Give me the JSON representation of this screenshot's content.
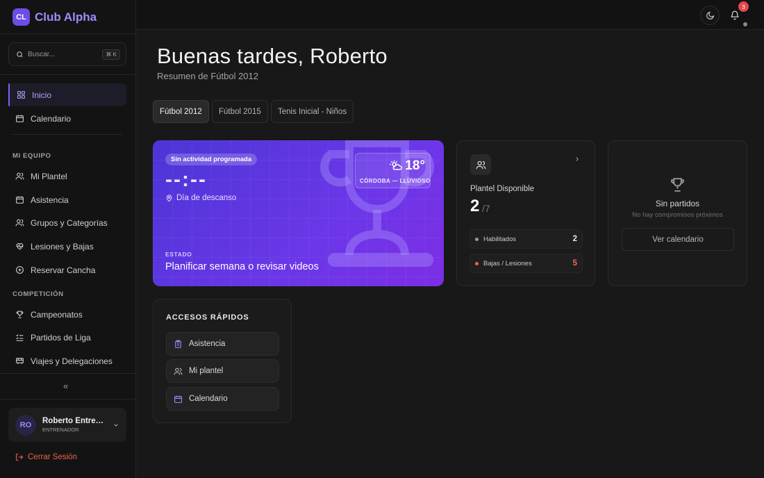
{
  "brand": {
    "logo": "CL",
    "name": "Club Alpha"
  },
  "search": {
    "placeholder": "Buscar...",
    "shortcut": "⌘ K"
  },
  "nav": {
    "main": [
      {
        "label": "Inicio",
        "icon": "grid-icon",
        "active": true
      },
      {
        "label": "Calendario",
        "icon": "calendar-icon"
      }
    ],
    "team_label": "MI EQUIPO",
    "team": [
      {
        "label": "Mi Plantel",
        "icon": "users-icon"
      },
      {
        "label": "Asistencia",
        "icon": "calendar-check-icon"
      },
      {
        "label": "Grupos y Categorías",
        "icon": "users-icon"
      },
      {
        "label": "Lesiones y Bajas",
        "icon": "heart-icon"
      },
      {
        "label": "Reservar Cancha",
        "icon": "plus-circle-icon"
      }
    ],
    "competition_label": "COMPETICIÓN",
    "competition": [
      {
        "label": "Campeonatos",
        "icon": "trophy-icon"
      },
      {
        "label": "Partidos de Liga",
        "icon": "list-check-icon"
      },
      {
        "label": "Viajes y Delegaciones",
        "icon": "bus-icon"
      }
    ],
    "collapse": "«"
  },
  "user": {
    "initials": "RO",
    "name": "Roberto Entrenador",
    "role": "ENTRENADOR"
  },
  "logout": "Cerrar Sesión",
  "topbar": {
    "notifications": "3"
  },
  "greeting": "Buenas tardes, Roberto",
  "subtitle": "Resumen de Fútbol 2012",
  "tabs": [
    "Fútbol 2012",
    "Fútbol 2015",
    "Tenis Inicial - Niños"
  ],
  "hero": {
    "pill": "Sin actividad programada",
    "time": "--:--",
    "rest": "Día de descanso",
    "estado_label": "ESTADO",
    "estado_value": "Planificar semana o revisar videos",
    "weather": {
      "temp": "18°",
      "location": "CÓRDOBA — LLUVIOSO"
    }
  },
  "plantel": {
    "label": "Plantel Disponible",
    "available": "2",
    "total": "/7",
    "rows": [
      {
        "label": "Habilitados",
        "value": "2",
        "color": "#9a9a9a",
        "value_color": "#e8e8eb"
      },
      {
        "label": "Bajas / Lesiones",
        "value": "5",
        "color": "#e8654f",
        "value_color": "#f06a55"
      }
    ]
  },
  "partidos": {
    "title": "Sin partidos",
    "subtitle": "No hay compromisos próximos",
    "button": "Ver calendario"
  },
  "quick": {
    "title": "ACCESOS RÁPIDOS",
    "items": [
      {
        "label": "Asistencia",
        "icon": "clipboard-icon"
      },
      {
        "label": "Mi plantel",
        "icon": "users-icon"
      },
      {
        "label": "Calendario",
        "icon": "calendar-icon"
      }
    ]
  },
  "colors": {
    "accent": "#7b62ff",
    "danger": "#e8654f",
    "background": "#181818"
  }
}
